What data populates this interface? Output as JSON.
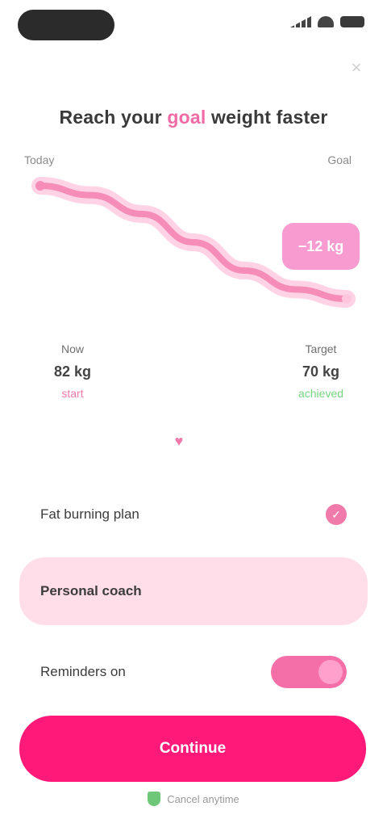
{
  "status_bar": {
    "time": ""
  },
  "header": {
    "close_label": "×",
    "title_pre": "Reach your ",
    "title_highlight": "goal",
    "title_post": " weight faster"
  },
  "chart": {
    "start_label": "Today",
    "end_label": "Goal",
    "goal_badge": "−12 kg"
  },
  "chart_data": {
    "type": "line",
    "x": [
      0,
      1,
      2,
      3,
      4,
      5,
      6
    ],
    "series": [
      {
        "values": [
          82,
          81,
          79,
          76,
          73,
          71,
          70
        ]
      }
    ],
    "xlabel": "",
    "ylabel": "",
    "grid": false
  },
  "stats": {
    "left": {
      "label": "Now",
      "value": "82 kg",
      "change": "start"
    },
    "right": {
      "label": "Target",
      "value": "70 kg",
      "change": "achieved"
    }
  },
  "options": [
    {
      "label": "Fat burning plan",
      "icon": "check-icon"
    },
    {
      "label": "Personal coach"
    },
    {
      "label": "Reminders on"
    }
  ],
  "cta": {
    "label": "Continue"
  },
  "footer": {
    "note": "Cancel anytime"
  },
  "colors": {
    "accent": "#ff1a7a",
    "accent_light": "#ffdde9",
    "badge": "#f79bd0",
    "positive": "#76d57f"
  }
}
